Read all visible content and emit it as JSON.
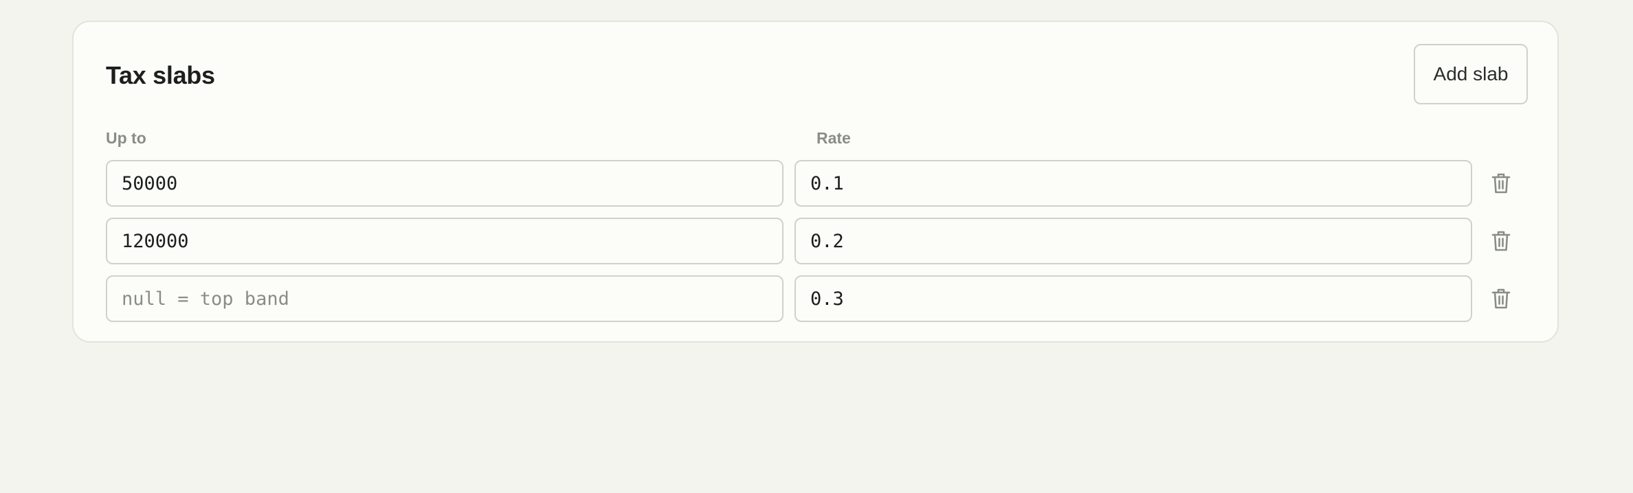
{
  "card": {
    "title": "Tax slabs",
    "add_button_label": "Add slab"
  },
  "columns": {
    "upto": "Up to",
    "rate": "Rate"
  },
  "rows": [
    {
      "upto": "50000",
      "upto_placeholder": "",
      "rate": "0.1"
    },
    {
      "upto": "120000",
      "upto_placeholder": "",
      "rate": "0.2"
    },
    {
      "upto": "",
      "upto_placeholder": "null = top band",
      "rate": "0.3"
    }
  ],
  "icons": {
    "delete": "trash-icon"
  },
  "colors": {
    "page_background": "#f4f4ef",
    "card_background": "#fcfdf8",
    "border": "#cfd1ca",
    "muted_text": "#8a8d87",
    "text": "#1c1f1c"
  }
}
